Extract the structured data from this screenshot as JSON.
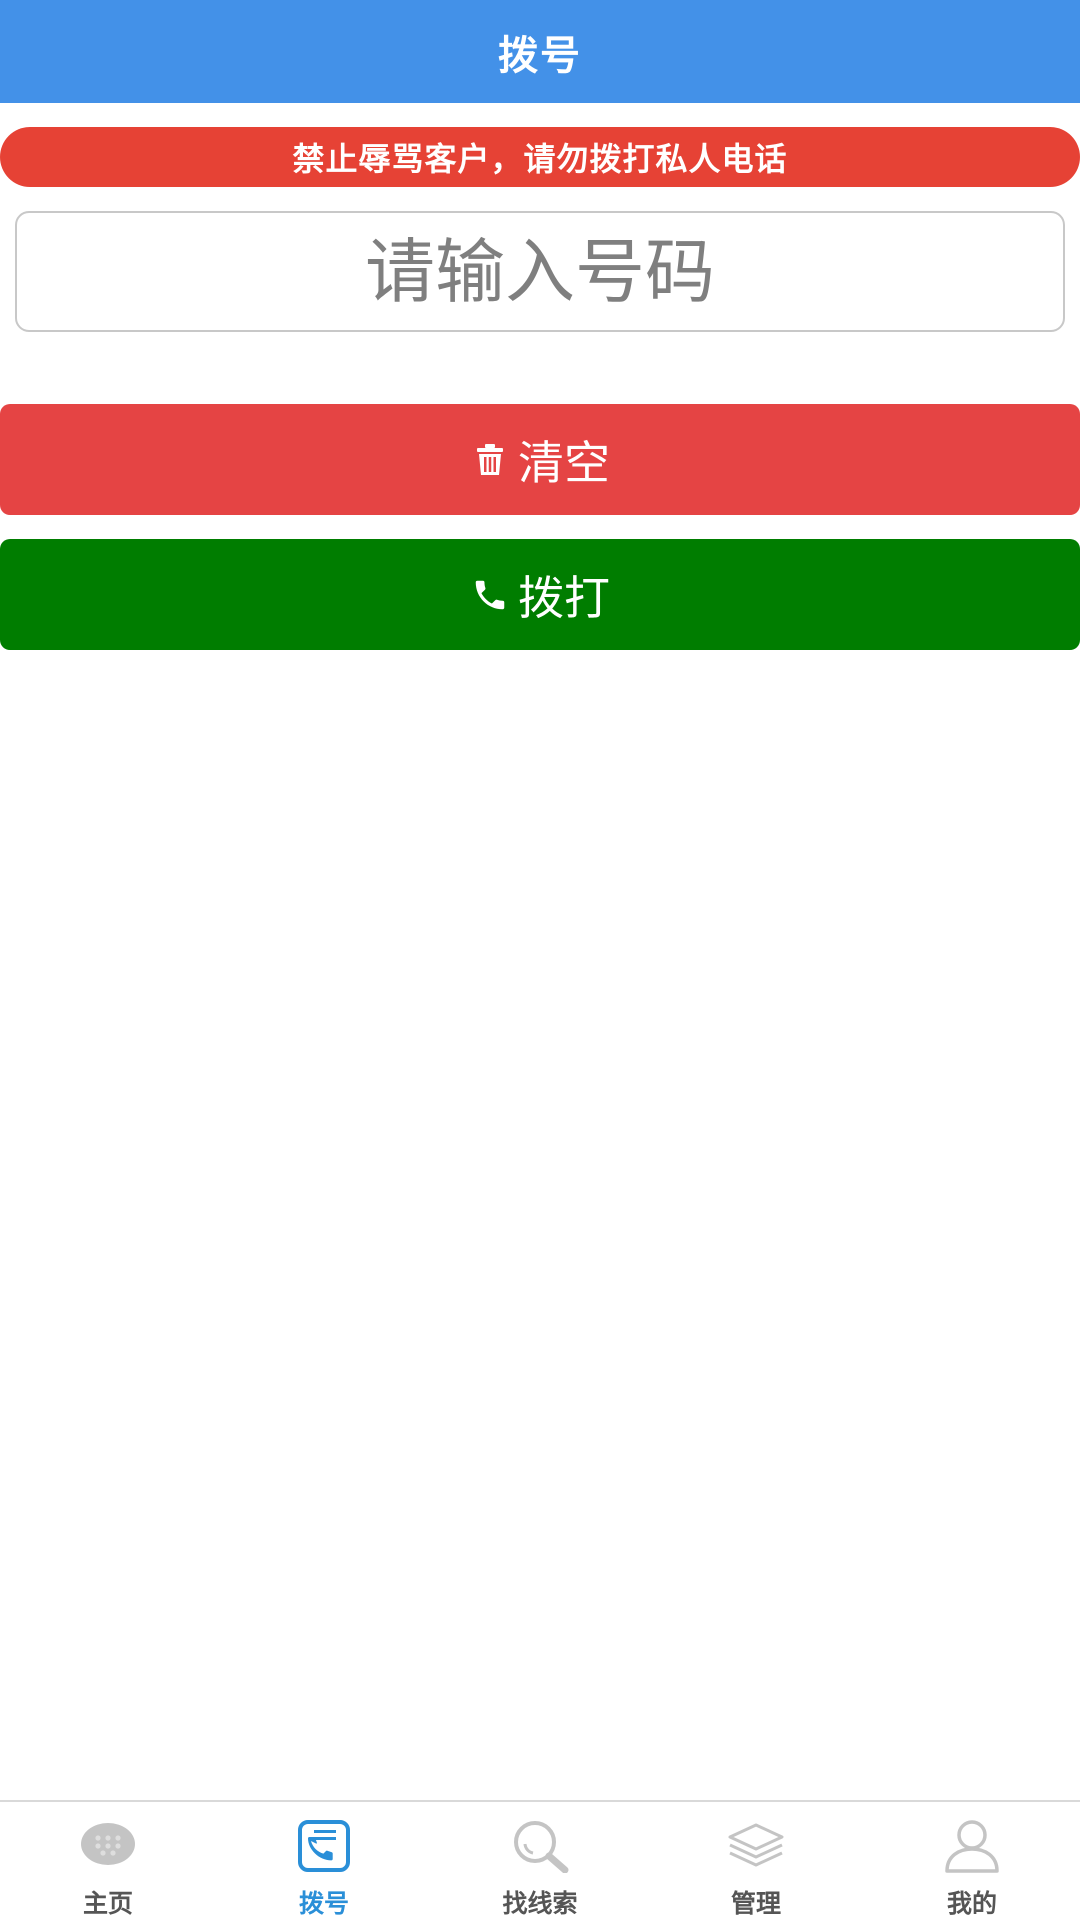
{
  "header": {
    "title": "拨号"
  },
  "warning": {
    "text": "禁止辱骂客户，请勿拨打私人电话"
  },
  "dialer": {
    "value": "",
    "placeholder": "请输入号码"
  },
  "buttons": {
    "clear_label": "清空",
    "dial_label": "拨打"
  },
  "tabbar": {
    "active": "拨号",
    "items": [
      {
        "label": "主页",
        "icon": "chat-bubble-icon"
      },
      {
        "label": "拨号",
        "icon": "phone-book-icon"
      },
      {
        "label": "找线索",
        "icon": "search-icon"
      },
      {
        "label": "管理",
        "icon": "layers-icon"
      },
      {
        "label": "我的",
        "icon": "user-icon"
      }
    ]
  },
  "colors": {
    "header": "#4391e8",
    "warning": "#e64235",
    "clear_button": "#e54444",
    "dial_button": "#007d00",
    "tab_active": "#2a8fd8",
    "tab_inactive": "#555555"
  }
}
